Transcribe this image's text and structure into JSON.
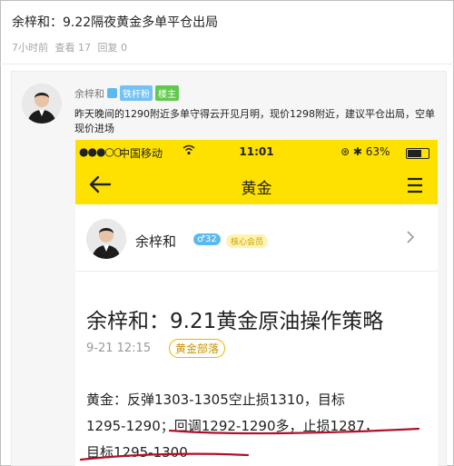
{
  "post": {
    "title": "余梓和：9.22隔夜黄金多单平仓出局",
    "time_ago": "7小时前",
    "views": "查看 17",
    "replies": "回复 0"
  },
  "reply": {
    "author": "余梓和",
    "tag_fans": "铁杆粉",
    "tag_owner": "楼主",
    "text": "昨天晚间的1290附近多单守得云开见月明，现价1298附近，建议平仓出局，空单现价进场"
  },
  "phone": {
    "status": {
      "signal": "●●●○○",
      "carrier": "中国移动",
      "time": "11:01",
      "battery": "63%"
    },
    "nav_title": "黄金",
    "author_name": "余梓和",
    "gender_badge": "♂32",
    "core_badge": "核心会员",
    "article_title": "余梓和：9.21黄金原油操作策略",
    "article_date": "9-21 12:15",
    "dept_tag": "黄金部落",
    "body_lines": [
      "黄金：反弹1303-1305空止损1310，目标",
      "1295-1290；回调1292-1290多，止损1287，",
      "目标1295-1300"
    ]
  },
  "colors": {
    "brand_yellow": "#ffe100",
    "underline_red": "#b0112a"
  }
}
